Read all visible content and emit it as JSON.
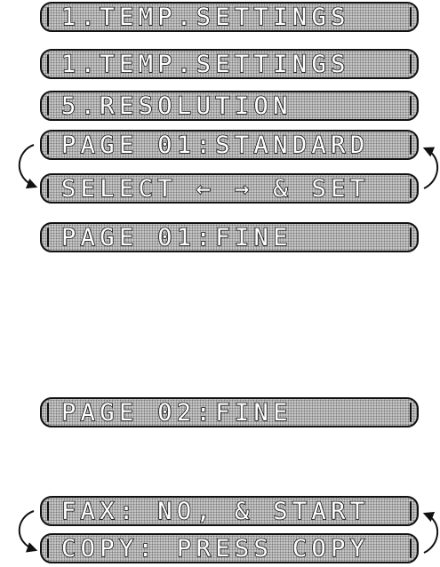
{
  "screens": [
    {
      "id": "screen-1",
      "text": "1.TEMP.SETTINGS"
    },
    {
      "id": "screen-2",
      "text": "1.TEMP.SETTINGS"
    },
    {
      "id": "screen-3",
      "text": "5.RESOLUTION"
    },
    {
      "id": "screen-4",
      "text": "PAGE 01:STANDARD"
    },
    {
      "id": "screen-5",
      "text": "SELECT ← → & SET"
    },
    {
      "id": "screen-6",
      "text": "PAGE 01:FINE"
    },
    {
      "id": "screen-7",
      "text": "PAGE 02:FINE"
    },
    {
      "id": "screen-8",
      "text": "FAX: NO, & START"
    },
    {
      "id": "screen-9",
      "text": "COPY: PRESS COPY"
    }
  ],
  "icons": {
    "cycle_arrows": "alternating-display-arrows-icon"
  },
  "colors": {
    "lcd_background": "#c9c9c9",
    "lcd_dots": "#7a7a7a",
    "outline": "#111111"
  }
}
